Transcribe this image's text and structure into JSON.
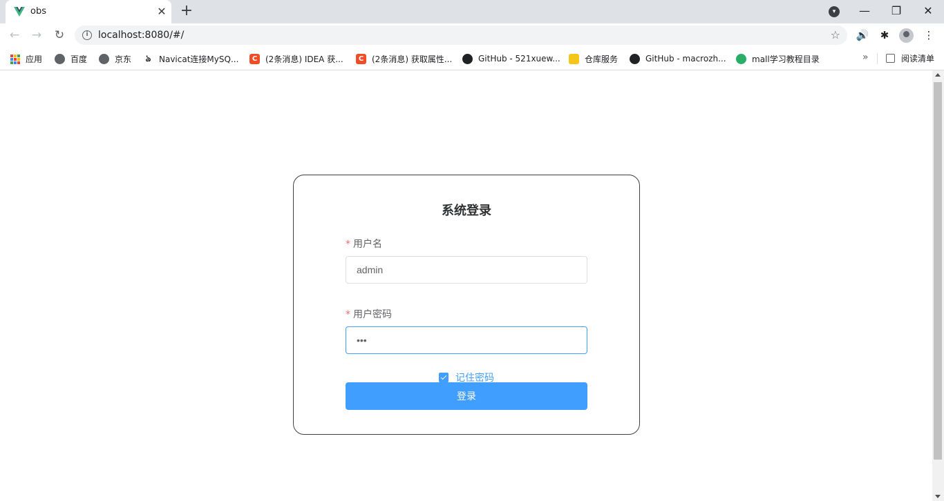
{
  "browser": {
    "tab_title": "obs",
    "url": "localhost:8080/#/",
    "bookmarks": [
      {
        "label": "应用",
        "icon": "apps-icon"
      },
      {
        "label": "百度",
        "icon": "globe-icon"
      },
      {
        "label": "京东",
        "icon": "globe-icon"
      },
      {
        "label": "Navicat连接MySQ...",
        "icon": "navicat-icon"
      },
      {
        "label": "(2条消息) IDEA 获...",
        "icon": "csdn-icon"
      },
      {
        "label": "(2条消息) 获取属性...",
        "icon": "csdn-icon"
      },
      {
        "label": "GitHub - 521xuew...",
        "icon": "github-icon"
      },
      {
        "label": "仓库服务",
        "icon": "warehouse-icon"
      },
      {
        "label": "GitHub - macrozh...",
        "icon": "github-icon"
      },
      {
        "label": "mall学习教程目录",
        "icon": "wechat-icon"
      }
    ],
    "reading_list": "阅读清单"
  },
  "login": {
    "title": "系统登录",
    "username_label": "用户名",
    "username_value": "admin",
    "password_label": "用户密码",
    "password_value": "•••",
    "remember_label": "记住密码",
    "remember_checked": true,
    "submit_label": "登录",
    "accent_color": "#409eff"
  }
}
